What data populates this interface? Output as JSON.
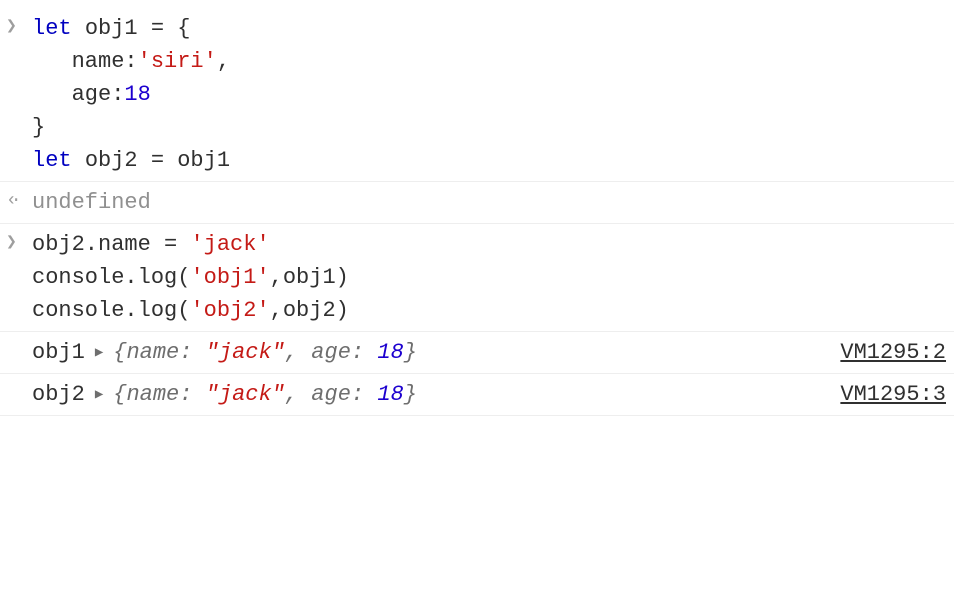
{
  "entries": [
    {
      "type": "input",
      "code": {
        "line1": {
          "let": "let",
          "var": "obj1",
          "eq": " = {"
        },
        "line2": {
          "indent": "   ",
          "prop": "name",
          "colon": ":",
          "string": "'siri'",
          "comma": ","
        },
        "line3": {
          "indent": "   ",
          "prop": "age",
          "colon": ":",
          "number": "18"
        },
        "line4": {
          "close": "}"
        },
        "line5": {
          "let": "let",
          "var": "obj2",
          "eq": " = obj1"
        }
      }
    },
    {
      "type": "output",
      "text": "undefined"
    },
    {
      "type": "input",
      "code2": {
        "line1": {
          "lhs": "obj2.name = ",
          "string": "'jack'"
        },
        "line2": {
          "pre": "console.log(",
          "str": "'obj1'",
          "mid": ",obj1)"
        },
        "line3": {
          "pre": "console.log(",
          "str": "'obj2'",
          "mid": ",obj2)"
        }
      }
    }
  ],
  "logs": [
    {
      "label": "obj1",
      "preview": {
        "open": "{",
        "p1name": "name: ",
        "p1val": "\"jack\"",
        "sep": ", ",
        "p2name": "age: ",
        "p2val": "18",
        "close": "}"
      },
      "source": "VM1295:2"
    },
    {
      "label": "obj2",
      "preview": {
        "open": "{",
        "p1name": "name: ",
        "p1val": "\"jack\"",
        "sep": ", ",
        "p2name": "age: ",
        "p2val": "18",
        "close": "}"
      },
      "source": "VM1295:3"
    }
  ]
}
